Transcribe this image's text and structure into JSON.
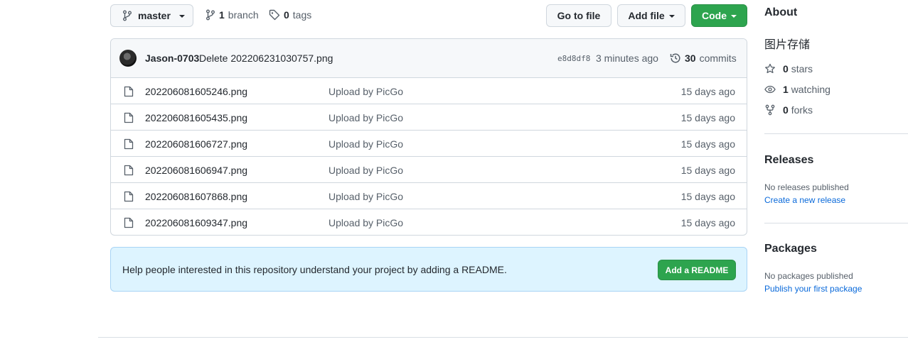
{
  "toolbar": {
    "branch_name": "master",
    "branches_count": "1",
    "branches_label": "branch",
    "tags_count": "0",
    "tags_label": "tags",
    "go_to_file": "Go to file",
    "add_file": "Add file",
    "code": "Code"
  },
  "commit": {
    "author": "Jason-0703",
    "message": "Delete 20220623103075 7.png",
    "sha": "e8d8df8",
    "time": "3 minutes ago",
    "commits_count": "30",
    "commits_label": "commits"
  },
  "files": [
    {
      "name": "202206081605246.png",
      "message": "Upload by PicGo",
      "time": "15 days ago"
    },
    {
      "name": "202206081605435.png",
      "message": "Upload by PicGo",
      "time": "15 days ago"
    },
    {
      "name": "202206081606727.png",
      "message": "Upload by PicGo",
      "time": "15 days ago"
    },
    {
      "name": "202206081606947.png",
      "message": "Upload by PicGo",
      "time": "15 days ago"
    },
    {
      "name": "202206081607868.png",
      "message": "Upload by PicGo",
      "time": "15 days ago"
    },
    {
      "name": "202206081609347.png",
      "message": "Upload by PicGo",
      "time": "15 days ago"
    }
  ],
  "readme": {
    "text": "Help people interested in this repository understand your project by adding a README.",
    "button": "Add a README"
  },
  "sidebar": {
    "about_title": "About",
    "description": "图片存储",
    "stars_count": "0",
    "stars_label": "stars",
    "watching_count": "1",
    "watching_label": "watching",
    "forks_count": "0",
    "forks_label": "forks",
    "releases_title": "Releases",
    "releases_empty": "No releases published",
    "releases_link": "Create a new release",
    "packages_title": "Packages",
    "packages_empty": "No packages published",
    "packages_link": "Publish your first package"
  },
  "colors": {
    "accent_green": "#2da44e",
    "link_blue": "#0969da",
    "banner_bg": "#ddf4ff"
  }
}
